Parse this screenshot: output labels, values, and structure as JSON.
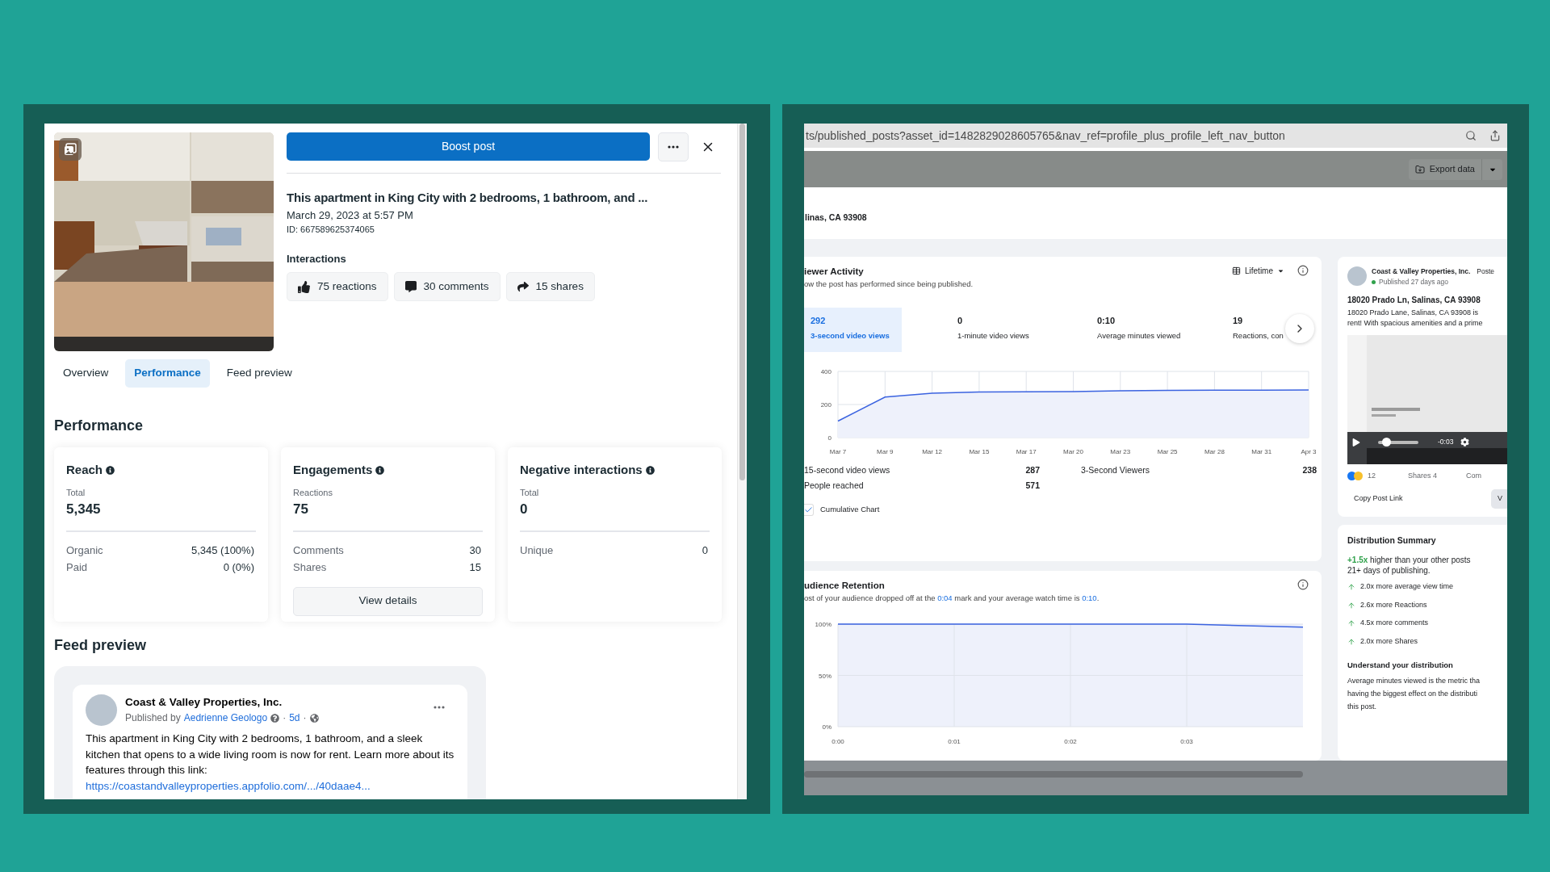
{
  "left_panel": {
    "boost_button": "Boost post",
    "title": "This apartment in King City with 2 bedrooms, 1 bathroom, and ...",
    "date": "March 29, 2023 at 5:57 PM",
    "id": "ID: 667589625374065",
    "interactions_label": "Interactions",
    "interactions": [
      {
        "kind": "reactions",
        "label": "75 reactions"
      },
      {
        "kind": "comments",
        "label": "30 comments"
      },
      {
        "kind": "shares",
        "label": "15 shares"
      }
    ],
    "tabs": [
      {
        "label": "Overview",
        "selected": false
      },
      {
        "label": "Performance",
        "selected": true
      },
      {
        "label": "Feed preview",
        "selected": false
      }
    ],
    "performance": {
      "heading": "Performance",
      "cards": [
        {
          "title": "Reach",
          "metric_label": "Total",
          "metric_value": "5,345",
          "rows": [
            {
              "label": "Organic",
              "value": "5,345 (100%)"
            },
            {
              "label": "Paid",
              "value": "0 (0%)"
            }
          ]
        },
        {
          "title": "Engagements",
          "metric_label": "Reactions",
          "metric_value": "75",
          "rows": [
            {
              "label": "Comments",
              "value": "30"
            },
            {
              "label": "Shares",
              "value": "15"
            }
          ],
          "button": "View details"
        },
        {
          "title": "Negative interactions",
          "metric_label": "Total",
          "metric_value": "0",
          "rows": [
            {
              "label": "Unique",
              "value": "0"
            }
          ]
        }
      ]
    },
    "feed_preview": {
      "heading": "Feed preview",
      "page_name": "Coast & Valley Properties, Inc.",
      "published_by": "Published by",
      "author": "Aedrienne Geologo",
      "separator": "·",
      "age": "5d",
      "body": "This apartment in King City with 2 bedrooms, 1 bathroom, and a sleek kitchen that opens to a wide living room is now for rent. Learn more about its features through this link:",
      "link": "https://coastandvalleyproperties.appfolio.com/.../40daae4..."
    }
  },
  "insights": {
    "url": "ts/published_posts?asset_id=1482829028605765&nav_ref=profile_plus_profile_left_nav_button",
    "export_button": "Export data",
    "location": "linas, CA 93908",
    "viewer_activity": {
      "title": "iewer Activity",
      "subtitle": "ow the post has performed since being published.",
      "period": "Lifetime",
      "metrics": [
        {
          "value": "292",
          "label": "3-second video views",
          "selected": true
        },
        {
          "value": "0",
          "label": "1-minute video views",
          "selected": false
        },
        {
          "value": "0:10",
          "label": "Average minutes viewed",
          "selected": false
        },
        {
          "value": "19",
          "label": "Reactions, con",
          "selected": false
        }
      ],
      "chart_data": {
        "type": "area",
        "categories": [
          "Mar 7",
          "Mar 9",
          "Mar 12",
          "Mar 15",
          "Mar 17",
          "Mar 20",
          "Mar 23",
          "Mar 25",
          "Mar 28",
          "Mar 31",
          "Apr 3"
        ],
        "values": [
          100,
          245,
          268,
          276,
          277,
          278,
          283,
          285,
          286,
          287,
          288
        ],
        "ylim": [
          0,
          400
        ],
        "yticks": [
          0,
          200,
          400
        ],
        "grid": true
      },
      "stats": [
        {
          "label": "15-second video views",
          "value": "287"
        },
        {
          "label": "3-Second Viewers",
          "value": "238"
        },
        {
          "label": "People reached",
          "value": "571"
        }
      ],
      "cumulative": {
        "label": "Cumulative Chart",
        "checked": true
      }
    },
    "audience_retention": {
      "title": "udience Retention",
      "before": "ost of your audience dropped off at the",
      "drop_time": "0:04",
      "middle": "mark and your average watch time is",
      "watch_time": "0:10",
      "after": ".",
      "chart_data": {
        "type": "line",
        "grid": true,
        "x": [
          0,
          1,
          2,
          3,
          4
        ],
        "values": [
          100,
          100,
          100,
          100,
          97
        ],
        "xlim": [
          0,
          4
        ],
        "ylim": [
          0,
          100
        ],
        "xticks": [
          {
            "value": 0,
            "label": "0:00"
          },
          {
            "value": 1,
            "label": "0:01"
          },
          {
            "value": 2,
            "label": "0:02"
          },
          {
            "value": 3,
            "label": "0:03"
          }
        ],
        "yticks": [
          {
            "value": 0,
            "label": "0%"
          },
          {
            "value": 50,
            "label": "50%"
          },
          {
            "value": 100,
            "label": "100%"
          }
        ]
      }
    },
    "post_card": {
      "page_name": "Coast & Valley Properties, Inc.",
      "posted": "Poste",
      "status": "Published 27 days ago",
      "title": "18020 Prado Ln, Salinas, CA 93908",
      "body_lines": [
        "18020 Prado Lane, Salinas, CA 93908 is",
        "rent! With spacious amenities and a prime"
      ],
      "video": {
        "kind": "picture",
        "time": "-0:03",
        "level": 0.2
      },
      "reaction_count": "12",
      "shares": "Shares 4",
      "comments": "Com",
      "copy_link": "Copy Post Link",
      "cut_button": "V"
    },
    "distribution": {
      "title": "Distribution Summary",
      "highlight": "+1.5x",
      "lead_lines": [
        "higher than your other posts",
        "21+ days of publishing."
      ],
      "items": [
        "2.0x more average view time",
        "2.6x more Reactions",
        "4.5x more comments",
        "2.0x more Shares"
      ],
      "subheading": "Understand your distribution",
      "body_lines": [
        "Average minutes viewed is the metric tha",
        "having the biggest effect on the distributi",
        "this post."
      ]
    }
  }
}
